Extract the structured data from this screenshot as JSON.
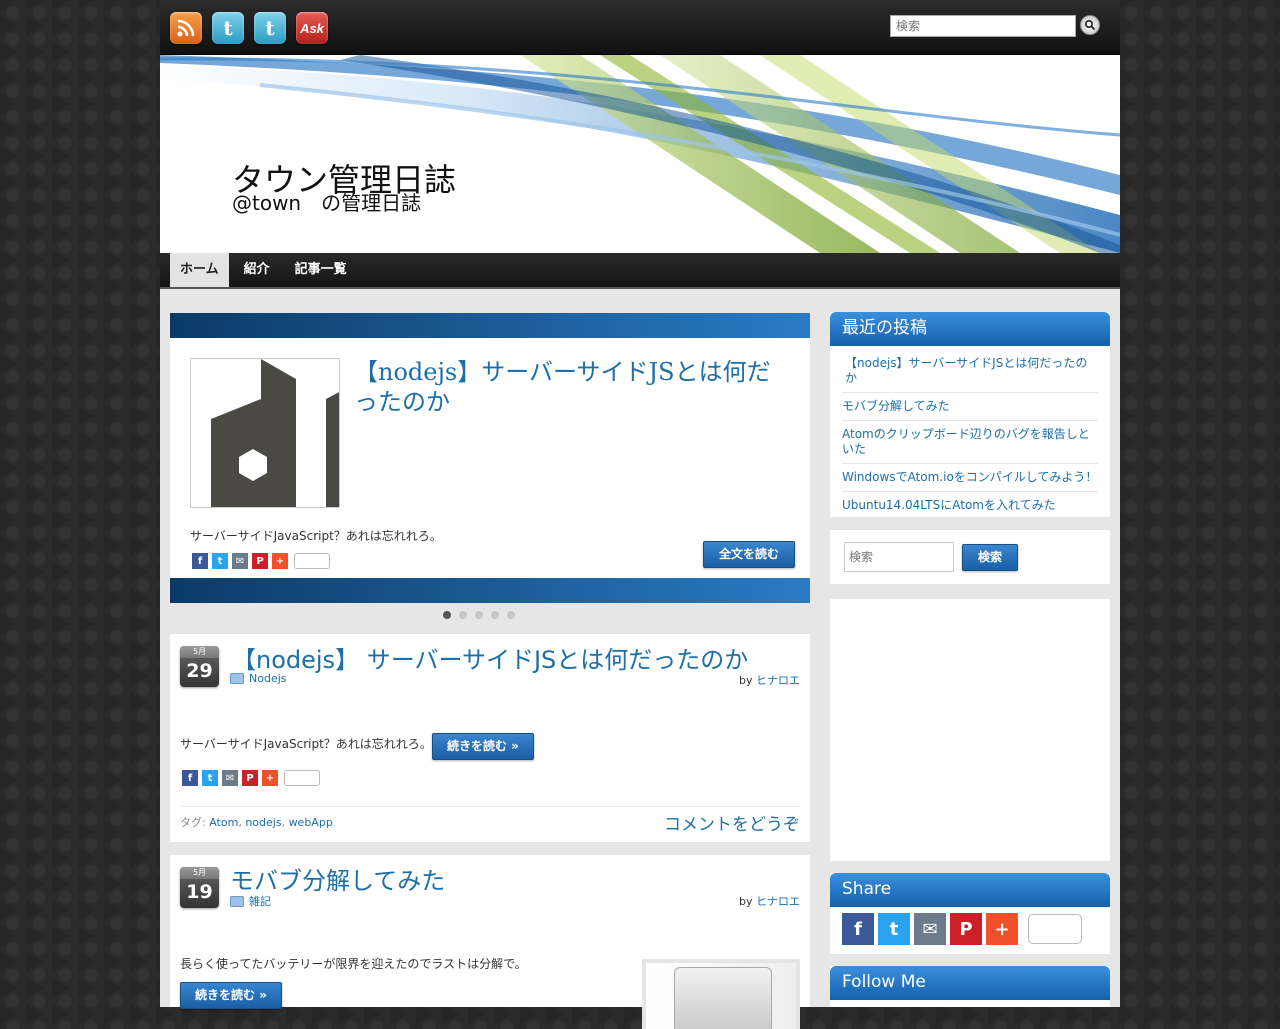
{
  "topbar": {
    "search_placeholder": "検索",
    "social_icons": [
      "rss-icon",
      "twitter-icon",
      "twitter-icon",
      "ask-icon"
    ],
    "ask_label": "Ask"
  },
  "header": {
    "title": "タウン管理日誌",
    "description": "@town　の管理日誌"
  },
  "nav": {
    "items": [
      {
        "label": "ホーム",
        "active": true
      },
      {
        "label": "紹介",
        "active": false
      },
      {
        "label": "記事一覧",
        "active": false
      }
    ]
  },
  "slider": {
    "title": "【nodejs】サーバーサイドJSとは何だったのか",
    "excerpt": "サーバーサイドJavaScript？あれは忘れれろ。",
    "read_more": "全文を読む",
    "dot_count": 5,
    "active_dot": 0
  },
  "posts": [
    {
      "month": "5月",
      "day": "29",
      "title": "【nodejs】 サーバーサイドJSとは何だったのか",
      "category": "Nodejs",
      "by_label": "by",
      "author": "ヒナロエ",
      "excerpt": "サーバーサイドJavaScript？あれは忘れれろ。",
      "read_more": "続きを読む »",
      "tags_label": "タグ:",
      "tags": [
        "Atom",
        "nodejs",
        "webApp"
      ],
      "comments": "コメントをどうぞ"
    },
    {
      "month": "5月",
      "day": "19",
      "title": "モバブ分解してみた",
      "category": "雑記",
      "by_label": "by",
      "author": "ヒナロエ",
      "excerpt": "長らく使ってたバッテリーが限界を迎えたのでラストは分解で。",
      "read_more": "続きを読む »"
    }
  ],
  "sidebar": {
    "recent_title": "最近の投稿",
    "recent": [
      "【nodejs】サーバーサイドJSとは何だったのか",
      "モバブ分解してみた",
      "Atomのクリップボード辺りのバグを報告しといた",
      "WindowsでAtom.ioをコンパイルしてみよう！",
      "Ubuntu14.04LTSにAtomを入れてみた"
    ],
    "search_placeholder": "検索",
    "search_button": "検索",
    "share_title": "Share",
    "follow_title": "Follow Me"
  },
  "colors": {
    "accent": "#1c6fa8",
    "widget_header": "#1f6fbf",
    "slider_band": "#0b3a66"
  }
}
